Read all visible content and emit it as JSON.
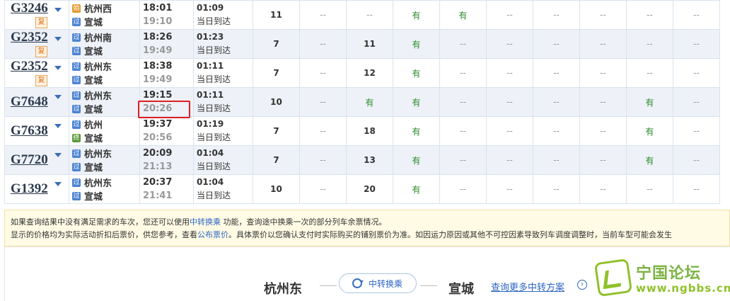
{
  "rows": [
    {
      "train": "G3246",
      "fu": "复",
      "from_type": "始",
      "from": "杭州西",
      "to_type": "过",
      "to": "宣城",
      "dep": "18:01",
      "arr": "19:10",
      "dur": "01:09",
      "day": "当日到达",
      "seats": [
        "11",
        "--",
        "--",
        "有",
        "有",
        "--",
        "--",
        "--",
        "--",
        "--"
      ]
    },
    {
      "train": "G2352",
      "fu": "复",
      "from_type": "过",
      "from": "杭州南",
      "to_type": "过",
      "to": "宣城",
      "dep": "18:26",
      "arr": "19:49",
      "dur": "01:23",
      "day": "当日到达",
      "seats": [
        "7",
        "--",
        "11",
        "有",
        "--",
        "--",
        "--",
        "--",
        "--",
        "--"
      ]
    },
    {
      "train": "G2352",
      "fu": "复",
      "from_type": "过",
      "from": "杭州东",
      "to_type": "过",
      "to": "宣城",
      "dep": "18:38",
      "arr": "19:49",
      "dur": "01:11",
      "day": "当日到达",
      "seats": [
        "7",
        "--",
        "12",
        "有",
        "--",
        "--",
        "--",
        "--",
        "--",
        "--"
      ]
    },
    {
      "train": "G7648",
      "fu": "",
      "from_type": "过",
      "from": "杭州东",
      "to_type": "过",
      "to": "宣城",
      "dep": "19:15",
      "arr": "20:26",
      "dur": "01:11",
      "day": "当日到达",
      "seats": [
        "10",
        "--",
        "有",
        "有",
        "--",
        "--",
        "--",
        "--",
        "有",
        "--"
      ]
    },
    {
      "train": "G7638",
      "fu": "",
      "from_type": "过",
      "from": "杭州",
      "to_type": "终",
      "to": "宣城",
      "dep": "19:37",
      "arr": "20:56",
      "dur": "01:19",
      "day": "当日到达",
      "seats": [
        "7",
        "--",
        "18",
        "有",
        "--",
        "--",
        "--",
        "--",
        "有",
        "--"
      ]
    },
    {
      "train": "G7720",
      "fu": "",
      "from_type": "过",
      "from": "杭州东",
      "to_type": "过",
      "to": "宣城",
      "dep": "20:09",
      "arr": "21:13",
      "dur": "01:04",
      "day": "当日到达",
      "seats": [
        "7",
        "--",
        "13",
        "有",
        "--",
        "--",
        "--",
        "--",
        "有",
        "--"
      ]
    },
    {
      "train": "G1392",
      "fu": "",
      "from_type": "过",
      "from": "杭州东",
      "to_type": "过",
      "to": "宣城",
      "dep": "20:37",
      "arr": "21:41",
      "dur": "01:04",
      "day": "当日到达",
      "seats": [
        "10",
        "--",
        "20",
        "有",
        "--",
        "--",
        "--",
        "--",
        "--",
        "--"
      ]
    }
  ],
  "notice": {
    "line1_a": "如果查询结果中没有满足需求的车次，您还可以使用",
    "line1_link": "中转换乘",
    "line1_b": " 功能，查询途中换乘一次的部分列车余票情况。",
    "line2_a": "显示的价格均为实际活动折扣后票价，供您参考，查看",
    "line2_link": "公布票价",
    "line2_b": "。具体票价以您确认支付时实际购买的铺别票价为准。如因运力原因或其他不可控因素导致列车调度调整时，当前车型可能会发生"
  },
  "transfer": {
    "from": "杭州东",
    "button": "中转换乘",
    "to": "宣城",
    "more": "查询更多中转方案",
    "arrow": "›"
  },
  "logo": {
    "title": "宁国论坛",
    "url": "www.ngbbs.cn"
  },
  "colors": {
    "link": "#2d66c4",
    "available": "#2a8a2a",
    "highlight": "#e02020",
    "logo": "#8fc12a"
  }
}
